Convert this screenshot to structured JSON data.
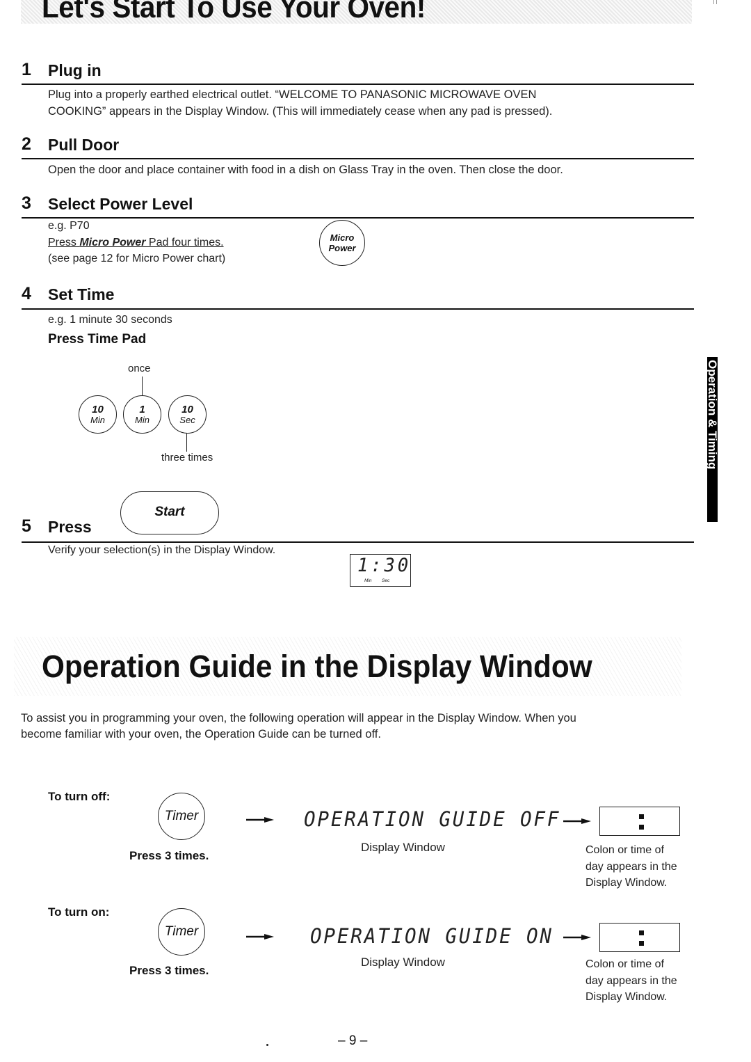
{
  "header": {
    "title": "Let's Start To Use Your Oven!"
  },
  "side_tab": {
    "label": "Operation & Timing"
  },
  "steps": [
    {
      "number": "1",
      "title": "Plug in",
      "text_line1": "Plug into a properly earthed electrical outlet. “WELCOME TO PANASONIC MICROWAVE OVEN",
      "text_line2": "COOKING” appears in the Display Window. (This will immediately cease when any pad is pressed)."
    },
    {
      "number": "2",
      "title": "Pull Door",
      "text": "Open the door and place container with food in a dish on Glass Tray in the oven. Then close the door."
    },
    {
      "number": "3",
      "title": "Select Power Level",
      "example": "e.g. P70",
      "instruction_prefix": "Press ",
      "instruction_pad": "Micro Power",
      "instruction_suffix": " Pad four times.",
      "note": "(see page 12 for Micro Power chart)",
      "pad": {
        "top": "Micro",
        "bottom": "Power"
      }
    },
    {
      "number": "4",
      "title": "Set Time",
      "example": "e.g. 1 minute 30 seconds",
      "subtitle": "Press Time Pad",
      "pads": [
        {
          "top": "10",
          "bottom": "Min"
        },
        {
          "top": "1",
          "bottom": "Min"
        },
        {
          "top": "10",
          "bottom": "Sec"
        }
      ],
      "label_once": "once",
      "label_three": "three times"
    },
    {
      "number": "5",
      "title": "Press",
      "button": "Start",
      "text": "Verify your selection(s) in the Display Window.",
      "display": {
        "value": "1:30",
        "min_label": "Min",
        "sec_label": "Sec"
      }
    }
  ],
  "guide": {
    "title": "Operation Guide in the Display Window",
    "intro_line1": "To assist you in programming your oven, the following operation will appear in the Display Window. When you",
    "intro_line2": "become familiar with your oven, the Operation Guide can be turned off.",
    "rows": [
      {
        "label": "To turn off:",
        "pad": "Timer",
        "press": "Press 3 times.",
        "display_text": "OPERATION GUIDE OFF",
        "display_caption": "Display Window",
        "result_line1": "Colon or time of",
        "result_line2": "day appears in the",
        "result_line3": "Display Window."
      },
      {
        "label": "To turn on:",
        "pad": "Timer",
        "press": "Press 3 times.",
        "display_text": "OPERATION GUIDE ON",
        "display_caption": "Display Window",
        "result_line1": "Colon or time of",
        "result_line2": "day appears in the",
        "result_line3": "Display Window."
      }
    ]
  },
  "footer": {
    "page_number": "– 9 –"
  }
}
